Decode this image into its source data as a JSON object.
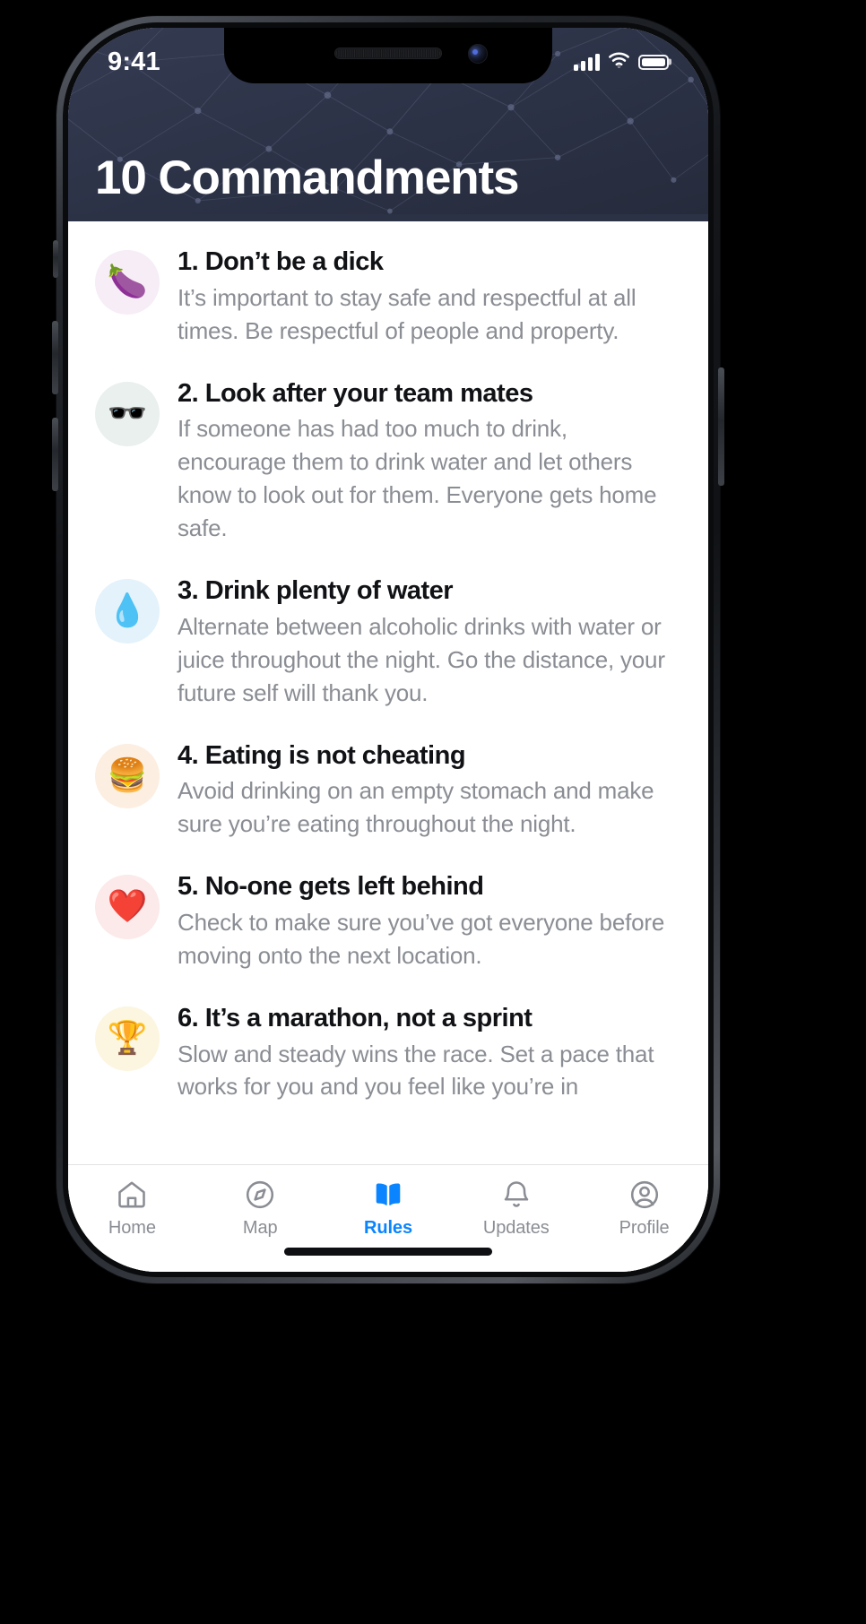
{
  "status_bar": {
    "time": "9:41",
    "cellular_icon": "cellular-signal-icon",
    "wifi_icon": "wifi-icon",
    "battery_icon": "battery-icon"
  },
  "header": {
    "title": "10 Commandments",
    "background_color": "#2C3246",
    "pattern": "constellation-network-pattern"
  },
  "colors": {
    "accent": "#0A84FF",
    "title_text": "#111215",
    "body_text": "#8A8D93",
    "surface": "#FFFFFF"
  },
  "rules": [
    {
      "number": "1.",
      "title": "1. Don’t be a dick",
      "desc": "It’s important to stay safe and respectful at all times. Be respectful of people and property.",
      "emoji": "🍆",
      "emoji_name": "eggplant-emoji",
      "badge_color": "#F6EDF6"
    },
    {
      "number": "2.",
      "title": "2. Look after your team mates",
      "desc": "If someone has had too much to drink, encourage them to drink water and let others know to look out for them. Everyone gets home safe.",
      "emoji": "🕶️",
      "emoji_name": "sunglasses-emoji",
      "badge_color": "#E9F0EE"
    },
    {
      "number": "3.",
      "title": "3. Drink plenty of water",
      "desc": "Alternate between alcoholic drinks with water or juice throughout the night. Go the distance, your future self will thank you.",
      "emoji": "💧",
      "emoji_name": "droplet-emoji",
      "badge_color": "#E4F2FB"
    },
    {
      "number": "4.",
      "title": "4. Eating is not cheating",
      "desc": "Avoid drinking on an empty stomach and make sure you’re eating throughout the night.",
      "emoji": "🍔",
      "emoji_name": "hamburger-emoji",
      "badge_color": "#FCEEE1"
    },
    {
      "number": "5.",
      "title": "5. No-one gets left behind",
      "desc": "Check to make sure you’ve got everyone before moving onto the next location.",
      "emoji": "❤️",
      "emoji_name": "red-heart-emoji",
      "badge_color": "#FCE9EA"
    },
    {
      "number": "6.",
      "title": "6. It’s a marathon, not a sprint",
      "desc": "Slow and steady wins the race. Set a pace that works for you and you feel like you’re in",
      "emoji": "🏆",
      "emoji_name": "trophy-emoji",
      "badge_color": "#FCF5DF"
    }
  ],
  "tabs": [
    {
      "label": "Home",
      "icon": "house-icon",
      "active": false
    },
    {
      "label": "Map",
      "icon": "compass-icon",
      "active": false
    },
    {
      "label": "Rules",
      "icon": "open-book-icon",
      "active": true
    },
    {
      "label": "Updates",
      "icon": "bell-icon",
      "active": false
    },
    {
      "label": "Profile",
      "icon": "person-circle-icon",
      "active": false
    }
  ]
}
